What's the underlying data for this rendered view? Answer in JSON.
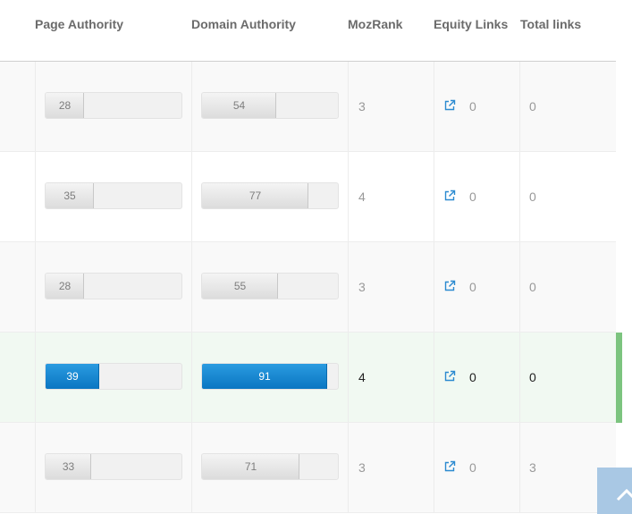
{
  "header": {
    "page_authority": "Page Authority",
    "domain_authority": "Domain Authority",
    "mozrank": "MozRank",
    "equity_links": "Equity Links",
    "total_links": "Total links"
  },
  "rows": [
    {
      "pa": 28,
      "pa_label": "28",
      "da": 54,
      "da_label": "54",
      "mozrank": "3",
      "equity": "0",
      "total": "0",
      "highlighted": false
    },
    {
      "pa": 35,
      "pa_label": "35",
      "da": 77,
      "da_label": "77",
      "mozrank": "4",
      "equity": "0",
      "total": "0",
      "highlighted": false
    },
    {
      "pa": 28,
      "pa_label": "28",
      "da": 55,
      "da_label": "55",
      "mozrank": "3",
      "equity": "0",
      "total": "0",
      "highlighted": false
    },
    {
      "pa": 39,
      "pa_label": "39",
      "da": 91,
      "da_label": "91",
      "mozrank": "4",
      "equity": "0",
      "total": "0",
      "highlighted": true
    },
    {
      "pa": 33,
      "pa_label": "33",
      "da": 71,
      "da_label": "71",
      "mozrank": "3",
      "equity": "0",
      "total": "3",
      "highlighted": false
    }
  ],
  "colors": {
    "accent": "#1a89d2",
    "highlight_marker": "#7cc47f",
    "scroll_button": "#a9c8e4"
  },
  "icons": {
    "equity_link": "external-link-icon",
    "scroll_top": "chevron-up-icon"
  }
}
